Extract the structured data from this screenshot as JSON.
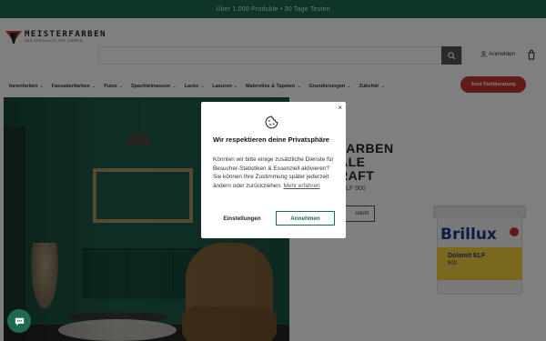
{
  "announcement": {
    "text": "Über 1.000 Produkte • 30 Tage Testen"
  },
  "header": {
    "logo_name": "MEISTERFARBEN",
    "logo_tagline": "DER SPEZIALIST FÜR FARBEN",
    "search_placeholder": "",
    "account_label": "Anmelden",
    "icons": {
      "search": "search-icon",
      "account": "user-icon",
      "cart": "cart-icon"
    }
  },
  "nav": {
    "items": [
      {
        "label": "Innenfarben"
      },
      {
        "label": "Fassadenfarben"
      },
      {
        "label": "Putze"
      },
      {
        "label": "Spachtelmassen"
      },
      {
        "label": "Lacke"
      },
      {
        "label": "Lasuren"
      },
      {
        "label": "Malervlies & Tapeten"
      },
      {
        "label": "Grundierungen"
      },
      {
        "label": "Zubehör"
      }
    ],
    "cta_label": "Jetzt Farbberatung"
  },
  "product": {
    "title_line1": "FARBEN",
    "title_line2": "ALE",
    "title_line3": "RAFT",
    "subtitle": "LF 900",
    "button_label": "odukt",
    "bucket_brand": "Brillux",
    "bucket_name": "Dolomit ELF",
    "bucket_number": "900"
  },
  "cookie_modal": {
    "title": "Wir respektieren deine Privatsphäre",
    "text": "Könnten wir bitte einige zusätzliche Dienste für Besucher-Statistiken & Essenziell aktivieren? Sie können Ihre Zustimmung später jederzeit ändern oder zurückziehen.",
    "link_label": "Mehr erfahren",
    "settings_label": "Einstellungen",
    "accept_label": "Annehmen",
    "close_label": "×",
    "icon": "cookie-icon"
  },
  "chat": {
    "icon": "chat-icon"
  },
  "colors": {
    "brand_green": "#1d6b4f",
    "accent_red": "#c0392b",
    "overlay": "rgba(0,0,0,0.5)"
  }
}
